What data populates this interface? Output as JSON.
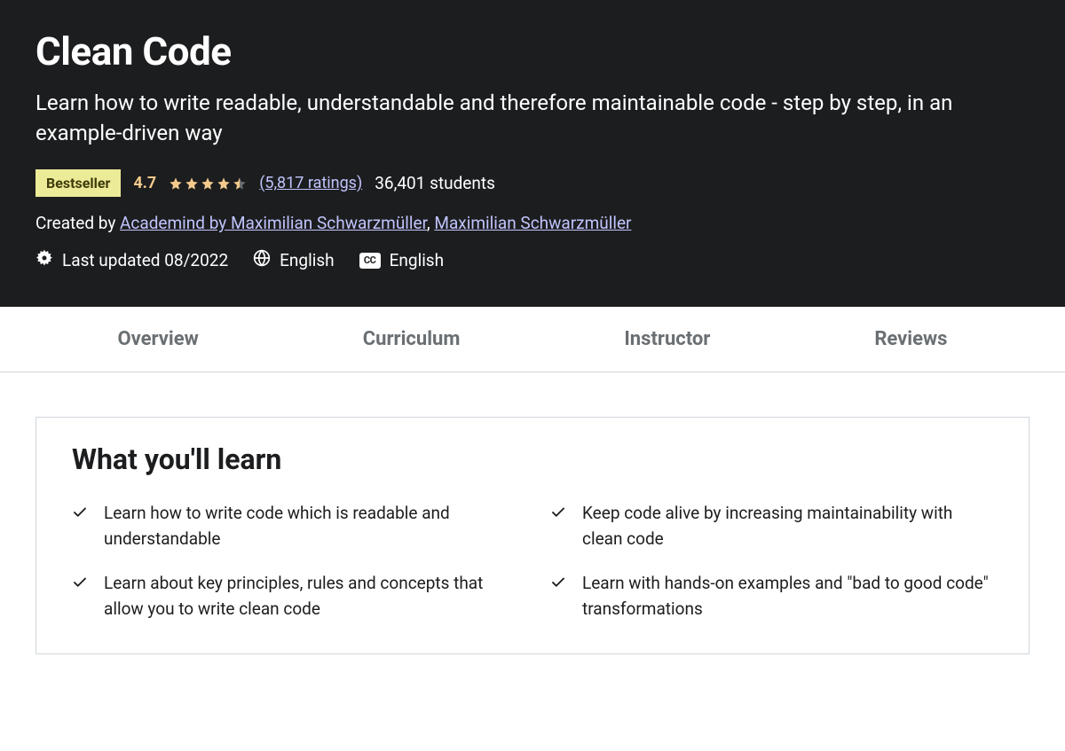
{
  "hero": {
    "title": "Clean Code",
    "subtitle": "Learn how to write readable, understandable and therefore maintainable code - step by step, in an example-driven way",
    "bestseller_label": "Bestseller",
    "rating_value": "4.7",
    "ratings_link": "(5,817 ratings)",
    "students": "36,401 students",
    "created_by_label": "Created by ",
    "creator1": "Academind by Maximilian Schwarzmüller",
    "creator_sep": ", ",
    "creator2": "Maximilian Schwarzmüller",
    "last_updated": "Last updated 08/2022",
    "language": "English",
    "captions": "English"
  },
  "tabs": {
    "overview": "Overview",
    "curriculum": "Curriculum",
    "instructor": "Instructor",
    "reviews": "Reviews"
  },
  "learn": {
    "heading": "What you'll learn",
    "items": [
      "Learn how to write code which is readable and understandable",
      "Keep code alive by increasing maintainability with clean code",
      "Learn about key principles, rules and concepts that allow you to write clean code",
      "Learn with hands-on examples and \"bad to good code\" transformations"
    ]
  }
}
